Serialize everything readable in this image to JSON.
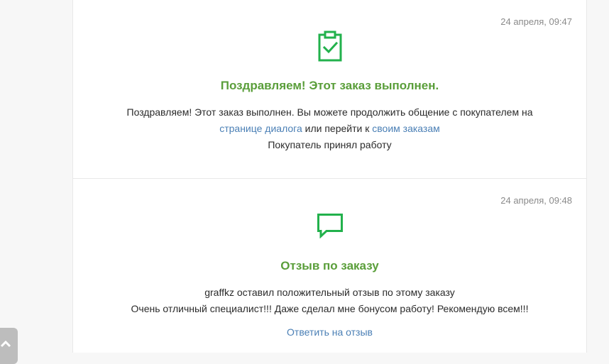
{
  "events": [
    {
      "timestamp": "24 апреля, 09:47",
      "icon": "clipboard-check-icon",
      "heading": "Поздравляем! Этот заказ выполнен.",
      "line1": "Поздравляем! Этот заказ выполнен. Вы можете продолжить общение с покупателем на",
      "dialog_link": "странице диалога",
      "or_text": " или перейти к ",
      "orders_link": "своим заказам",
      "line3": "Покупатель принял работу"
    },
    {
      "timestamp": "24 апреля, 09:48",
      "icon": "chat-bubble-icon",
      "heading": "Отзыв по заказу",
      "line1": "graffkz оставил положительный отзыв по этому заказу",
      "line2": "Очень отличный специалист!!! Даже сделал мне бонусом работу! Рекомендую всем!!!",
      "reply_link": "Ответить на отзыв"
    }
  ],
  "colors": {
    "accent_green": "#22b14c",
    "heading_green": "#5a9e3a",
    "link_blue": "#4a7fb5"
  },
  "scroll_top_icon": "chevron-up-icon"
}
